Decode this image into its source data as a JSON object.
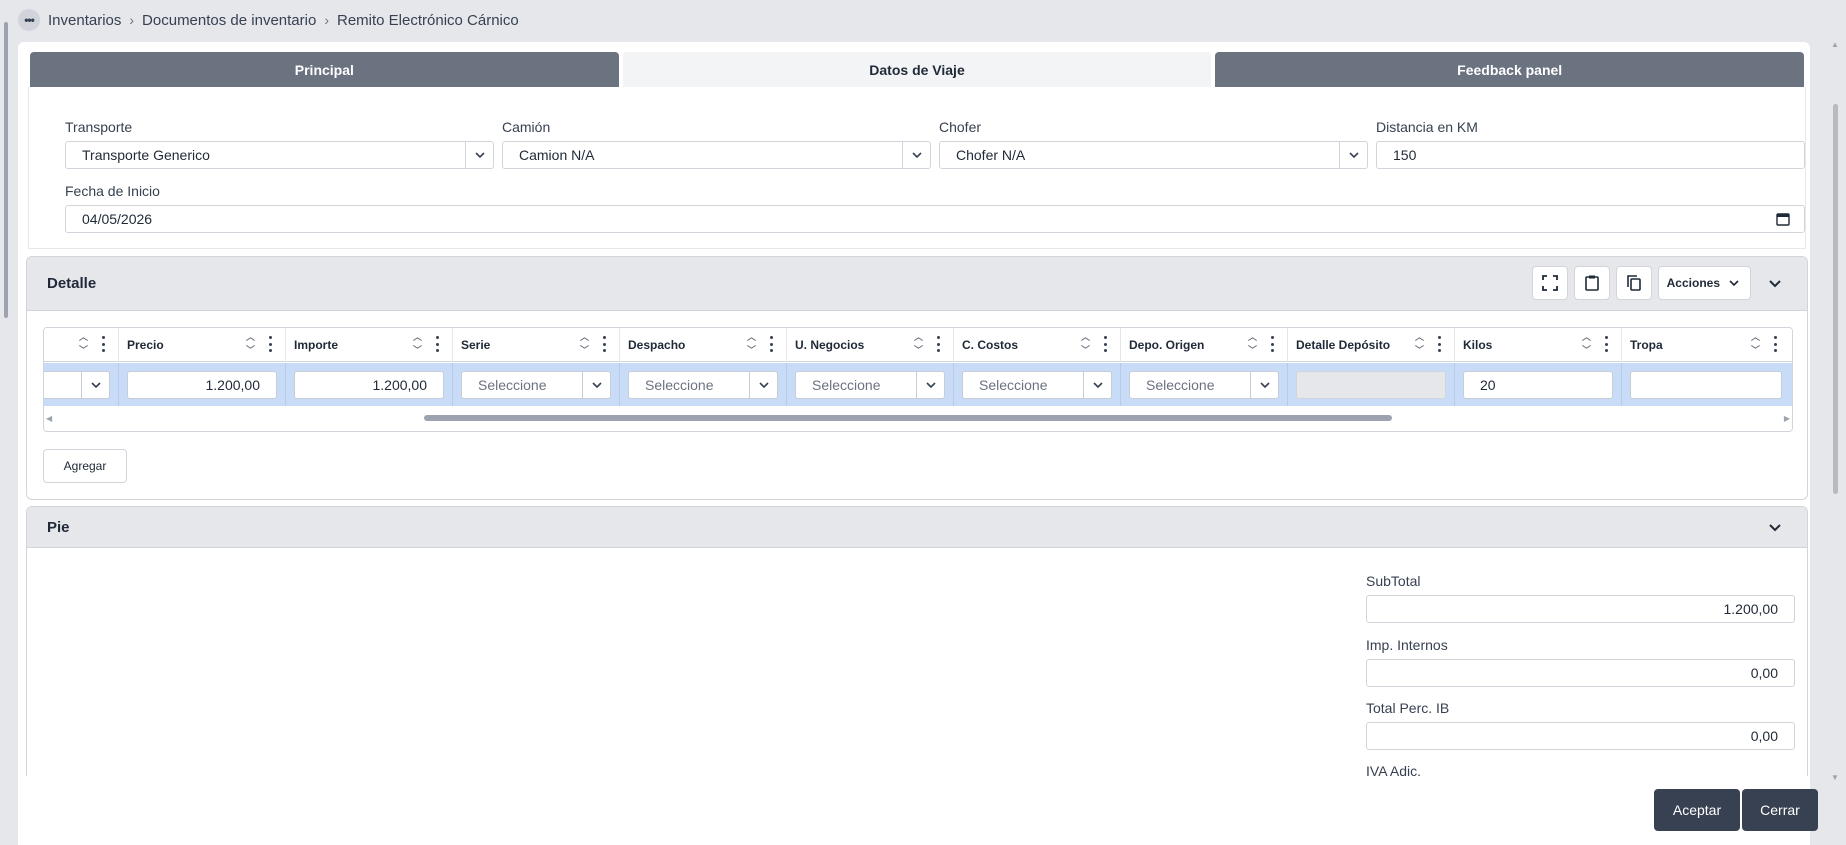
{
  "breadcrumb": {
    "items": [
      "Inventarios",
      "Documentos de inventario",
      "Remito Electrónico Cárnico"
    ]
  },
  "tabs": [
    {
      "label": "Principal",
      "active": false
    },
    {
      "label": "Datos de Viaje",
      "active": true
    },
    {
      "label": "Feedback panel",
      "active": false
    }
  ],
  "viaje": {
    "transporte": {
      "label": "Transporte",
      "value": "Transporte Generico"
    },
    "camion": {
      "label": "Camión",
      "value": "Camion N/A"
    },
    "chofer": {
      "label": "Chofer",
      "value": "Chofer N/A"
    },
    "distancia": {
      "label": "Distancia en KM",
      "value": "150"
    },
    "fecha_inicio": {
      "label": "Fecha de Inicio",
      "value": "04/05/2026"
    }
  },
  "detalle": {
    "title": "Detalle",
    "acciones_label": "Acciones",
    "columns": [
      "Precio",
      "Importe",
      "Serie",
      "Despacho",
      "U. Negocios",
      "C. Costos",
      "Depo. Origen",
      "Detalle Depósito",
      "Kilos",
      "Tropa"
    ],
    "row": {
      "precio": "1.200,00",
      "importe": "1.200,00",
      "serie": "Seleccione",
      "despacho": "Seleccione",
      "u_negocios": "Seleccione",
      "c_costos": "Seleccione",
      "depo_origen": "Seleccione",
      "detalle_deposito": "",
      "kilos": "20",
      "tropa": ""
    },
    "agregar_label": "Agregar"
  },
  "pie": {
    "title": "Pie",
    "subtotal": {
      "label": "SubTotal",
      "value": "1.200,00"
    },
    "imp_internos": {
      "label": "Imp. Internos",
      "value": "0,00"
    },
    "total_perc_ib": {
      "label": "Total Perc. IB",
      "value": "0,00"
    },
    "iva_adic": {
      "label": "IVA Adic."
    }
  },
  "footer": {
    "aceptar_label": "Aceptar",
    "cerrar_label": "Cerrar"
  },
  "colors": {
    "tab_inactive": "#6b7280",
    "row_selected": "#c9dcf7",
    "button_dark": "#374151"
  }
}
